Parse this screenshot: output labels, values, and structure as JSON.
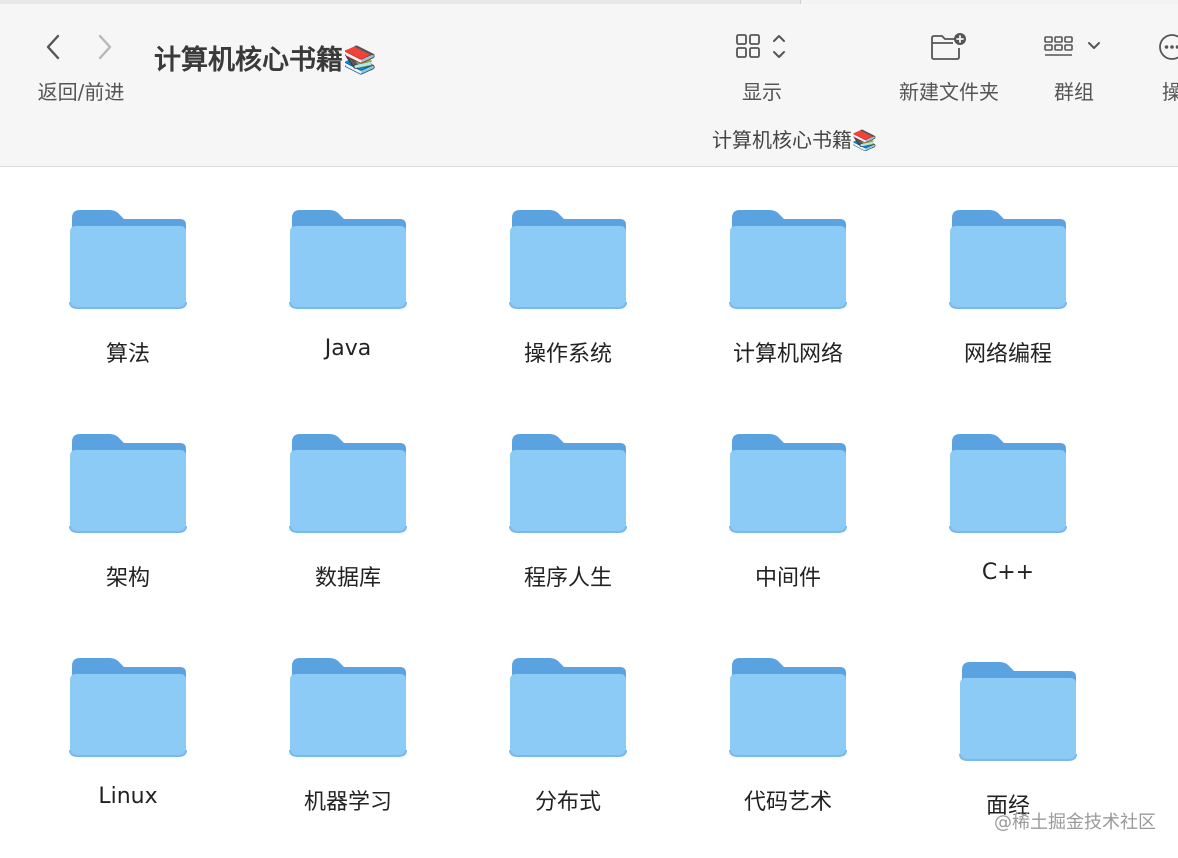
{
  "nav": {
    "label": "返回/前进",
    "back_glyph": "‹",
    "forward_glyph": "›"
  },
  "window": {
    "title": "计算机核心书籍📚"
  },
  "toolbar": {
    "view_label": "显示",
    "newfolder_label": "新建文件夹",
    "group_label": "群组",
    "action_label": "操",
    "icons": [
      "grid-view-icon",
      "new-folder-icon",
      "group-icon",
      "more-icon"
    ]
  },
  "path": {
    "label": "计算机核心书籍📚"
  },
  "folders": [
    {
      "name": "算法"
    },
    {
      "name": "Java"
    },
    {
      "name": "操作系统"
    },
    {
      "name": "计算机网络"
    },
    {
      "name": "网络编程"
    },
    {
      "name": "架构"
    },
    {
      "name": "数据库"
    },
    {
      "name": "程序人生"
    },
    {
      "name": "中间件"
    },
    {
      "name": "C++"
    },
    {
      "name": "Linux"
    },
    {
      "name": "机器学习"
    },
    {
      "name": "分布式"
    },
    {
      "name": "代码艺术"
    },
    {
      "name": "面经"
    }
  ],
  "watermark": "@稀土掘金技术社区",
  "colors": {
    "folder_back": "#5aa3e0",
    "folder_front": "#8ccbf6",
    "folder_edge": "#79b9ec",
    "toolbar_bg": "#f6f6f6"
  }
}
